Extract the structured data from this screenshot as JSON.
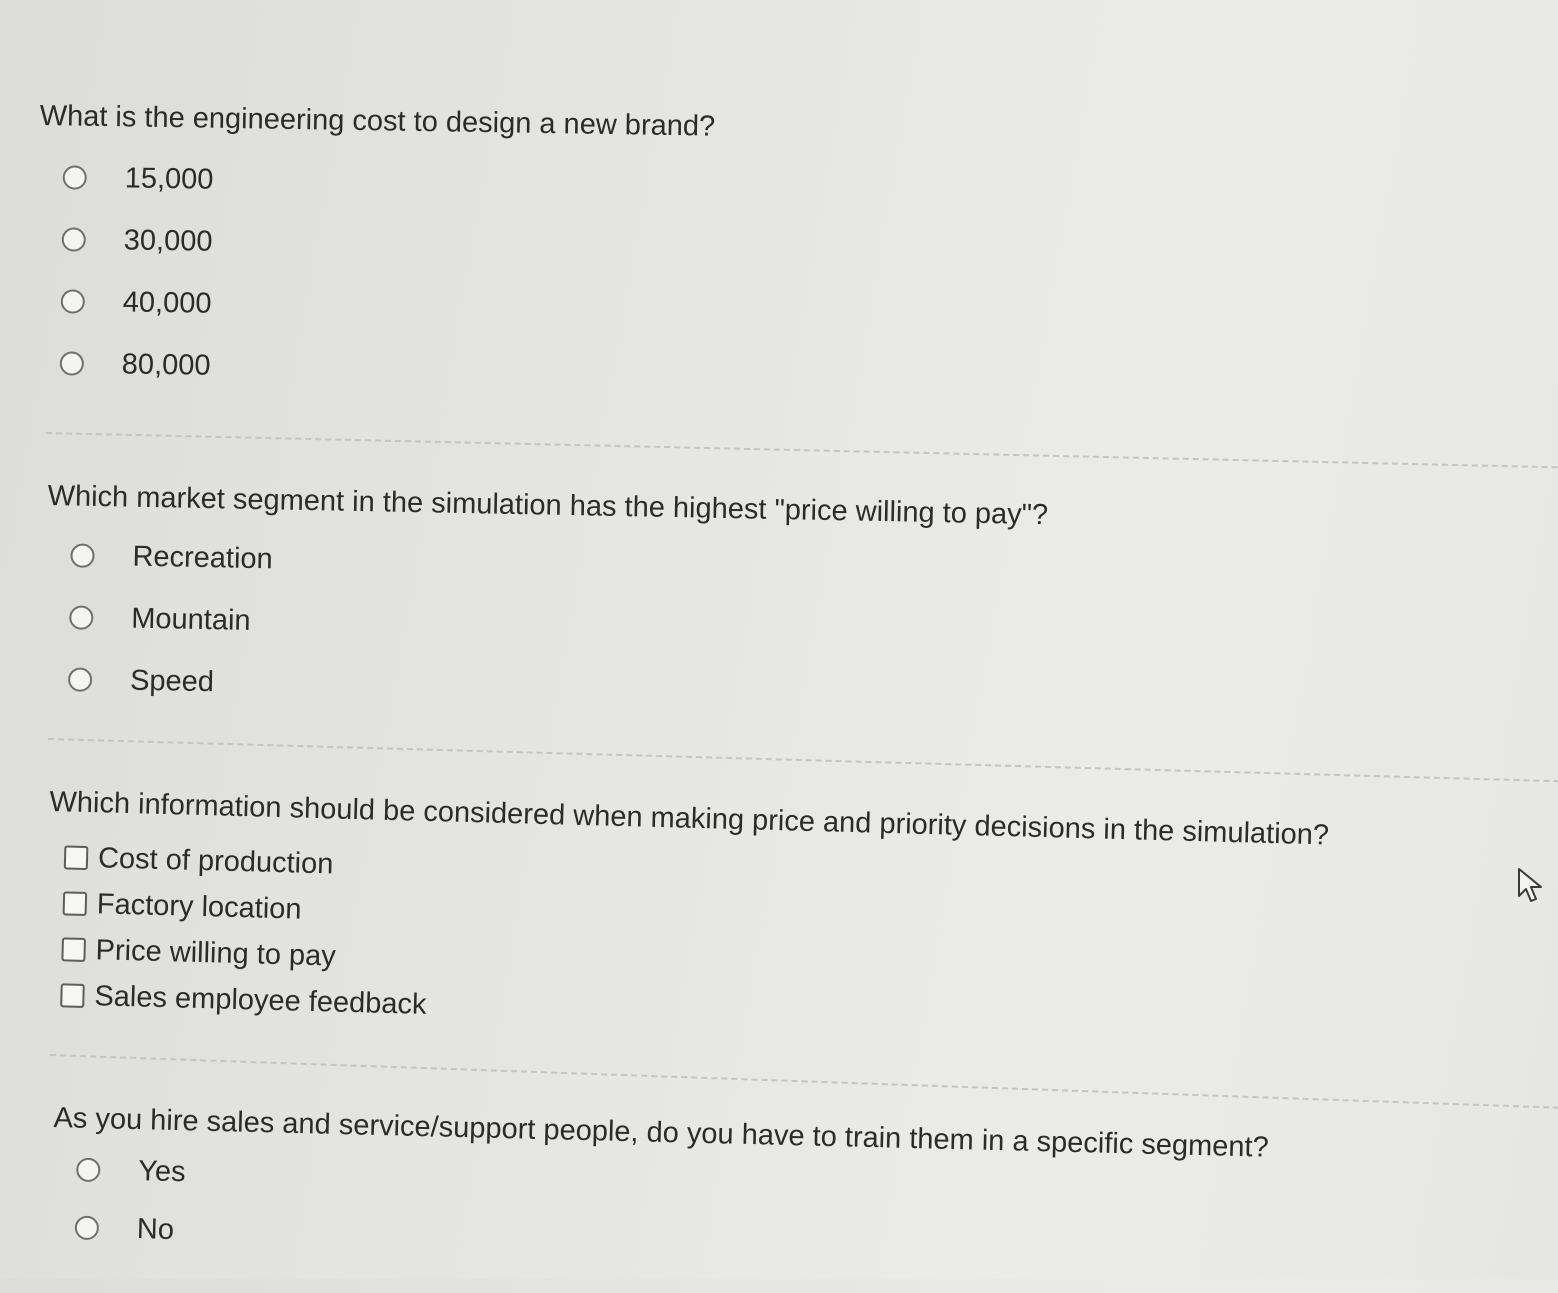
{
  "questions": [
    {
      "text": "What is the engineering cost to design a new brand?",
      "type": "radio",
      "options": [
        "15,000",
        "30,000",
        "40,000",
        "80,000"
      ]
    },
    {
      "text": "Which market segment in the simulation has the highest \"price willing to pay\"?",
      "type": "radio",
      "options": [
        "Recreation",
        "Mountain",
        "Speed"
      ]
    },
    {
      "text": "Which information should be considered when making price and priority decisions in the simulation?",
      "type": "checkbox",
      "options": [
        "Cost of production",
        "Factory location",
        "Price willing to pay",
        "Sales employee feedback"
      ]
    },
    {
      "text": "As you hire sales and service/support people, do you have to train them in a specific segment?",
      "type": "radio",
      "options": [
        "Yes",
        "No"
      ]
    }
  ],
  "cursor_icon": "arrow-pointer-icon"
}
